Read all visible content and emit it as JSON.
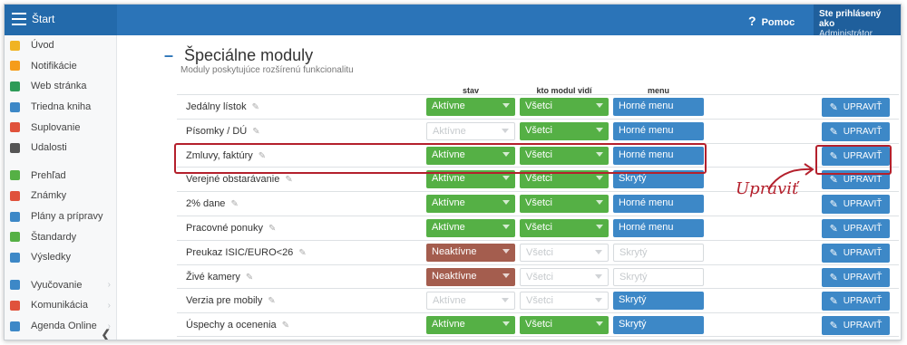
{
  "topbar": {
    "title": "Štart",
    "help_label": "Pomoc",
    "user_line1": "Ste prihlásený ako",
    "user_line2": "Administrátor"
  },
  "sidebar": {
    "group1": [
      {
        "label": "Úvod",
        "icon": "star-icon",
        "color": "#f0b323"
      },
      {
        "label": "Notifikácie",
        "icon": "envelope-icon",
        "color": "#f59c1a"
      },
      {
        "label": "Web stránka",
        "icon": "home-icon",
        "color": "#2e9b58"
      },
      {
        "label": "Triedna kniha",
        "icon": "book-icon",
        "color": "#3d88c7"
      },
      {
        "label": "Suplovanie",
        "icon": "person-icon",
        "color": "#e0523c"
      },
      {
        "label": "Udalosti",
        "icon": "calendar-icon",
        "color": "#555555"
      }
    ],
    "group2": [
      {
        "label": "Prehľad",
        "icon": "check-circle-icon",
        "color": "#55b045"
      },
      {
        "label": "Známky",
        "icon": "grade-icon",
        "color": "#e0523c"
      },
      {
        "label": "Plány a prípravy",
        "icon": "folder-icon",
        "color": "#3d88c7"
      },
      {
        "label": "Štandardy",
        "icon": "shield-icon",
        "color": "#55b045"
      },
      {
        "label": "Výsledky",
        "icon": "bar-chart-icon",
        "color": "#3d88c7"
      }
    ],
    "group3": [
      {
        "label": "Vyučovanie",
        "icon": "briefcase-icon",
        "color": "#3d88c7"
      },
      {
        "label": "Komunikácia",
        "icon": "chat-icon",
        "color": "#e0523c"
      },
      {
        "label": "Agenda Online",
        "icon": "pen-icon",
        "color": "#3d88c7"
      }
    ]
  },
  "main": {
    "title": "Špeciálne moduly",
    "subtitle": "Moduly poskytujúce rozšírenú funkcionalitu",
    "col_stav": "stav",
    "col_kto": "kto modul vidí",
    "col_menu": "menu",
    "edit_label": "UPRAVIŤ",
    "rows": [
      {
        "name": "Jedálny lístok",
        "stav": "Aktívne",
        "stav_style": "green",
        "kto": "Všetci",
        "kto_style": "green",
        "menu": "Horné menu",
        "menu_style": "blue"
      },
      {
        "name": "Písomky / DÚ",
        "stav": "Aktívne",
        "stav_style": "disabled",
        "kto": "Všetci",
        "kto_style": "green",
        "menu": "Horné menu",
        "menu_style": "blue"
      },
      {
        "name": "Zmluvy, faktúry",
        "stav": "Aktívne",
        "stav_style": "green",
        "kto": "Všetci",
        "kto_style": "green",
        "menu": "Horné menu",
        "menu_style": "blue"
      },
      {
        "name": "Verejné obstarávanie",
        "stav": "Aktívne",
        "stav_style": "green",
        "kto": "Všetci",
        "kto_style": "green",
        "menu": "Skrytý",
        "menu_style": "blue"
      },
      {
        "name": "2% dane",
        "stav": "Aktívne",
        "stav_style": "green",
        "kto": "Všetci",
        "kto_style": "green",
        "menu": "Horné menu",
        "menu_style": "blue"
      },
      {
        "name": "Pracovné ponuky",
        "stav": "Aktívne",
        "stav_style": "green",
        "kto": "Všetci",
        "kto_style": "green",
        "menu": "Horné menu",
        "menu_style": "blue"
      },
      {
        "name": "Preukaz ISIC/EURO<26",
        "stav": "Neaktívne",
        "stav_style": "brown",
        "kto": "Všetci",
        "kto_style": "disabled",
        "menu": "Skrytý",
        "menu_style": "disabled"
      },
      {
        "name": "Živé kamery",
        "stav": "Neaktívne",
        "stav_style": "brown",
        "kto": "Všetci",
        "kto_style": "disabled",
        "menu": "Skrytý",
        "menu_style": "disabled"
      },
      {
        "name": "Verzia pre mobily",
        "stav": "Aktívne",
        "stav_style": "disabled",
        "kto": "Všetci",
        "kto_style": "disabled",
        "menu": "Skrytý",
        "menu_style": "blue"
      },
      {
        "name": "Úspechy a ocenenia",
        "stav": "Aktívne",
        "stav_style": "green",
        "kto": "Všetci",
        "kto_style": "green",
        "menu": "Skrytý",
        "menu_style": "blue"
      }
    ]
  },
  "annotation": {
    "text": "Upraviť",
    "color": "#b4202c",
    "highlighted_row": "Zmluvy, faktúry"
  }
}
